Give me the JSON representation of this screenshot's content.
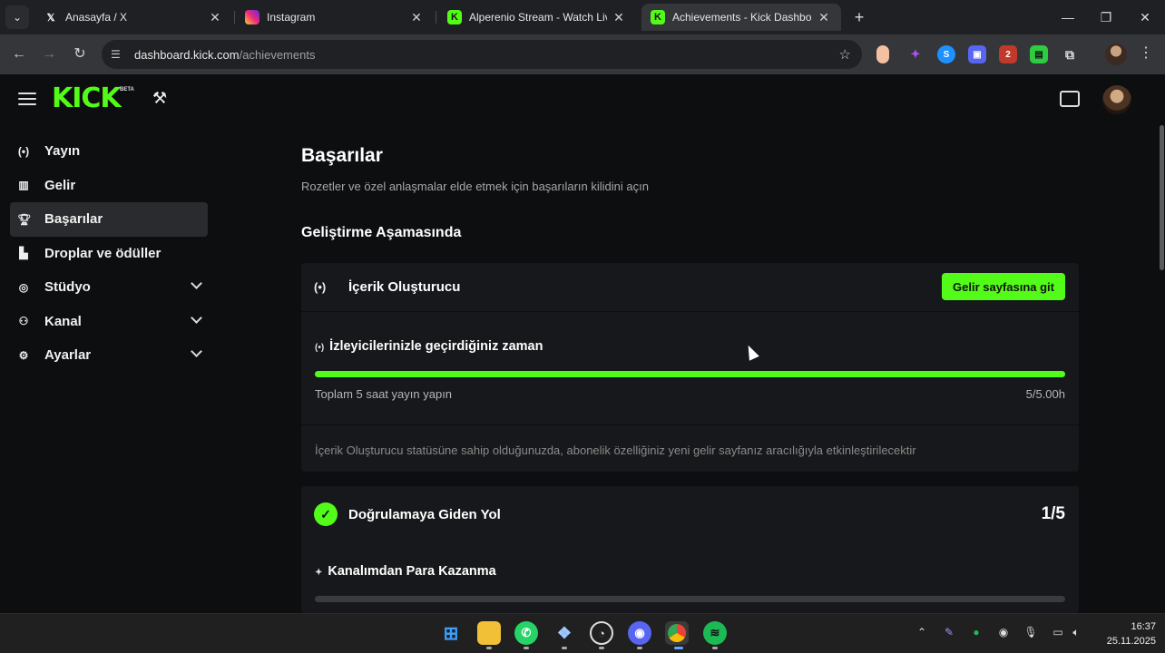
{
  "browser": {
    "tabs": [
      {
        "title": "Anasayfa / X",
        "icon": "x-logo-icon",
        "active": false
      },
      {
        "title": "Instagram",
        "icon": "instagram-icon",
        "active": false
      },
      {
        "title": "Alperenio Stream - Watch Live o",
        "icon": "kick-icon",
        "active": false
      },
      {
        "title": "Achievements - Kick Dashboard",
        "icon": "kick-icon",
        "active": true
      }
    ],
    "url_host": "dashboard.kick.com",
    "url_path": "/achievements"
  },
  "header": {
    "logo_text": "KICK",
    "beta_tag": "BETA"
  },
  "sidebar": {
    "items": [
      {
        "label": "Yayın",
        "icon": "broadcast-icon",
        "active": false,
        "expandable": false
      },
      {
        "label": "Gelir",
        "icon": "revenue-icon",
        "active": false,
        "expandable": false
      },
      {
        "label": "Başarılar",
        "icon": "trophy-icon",
        "active": true,
        "expandable": false
      },
      {
        "label": "Droplar ve ödüller",
        "icon": "gift-icon",
        "active": false,
        "expandable": false
      },
      {
        "label": "Stüdyo",
        "icon": "studio-icon",
        "active": false,
        "expandable": true
      },
      {
        "label": "Kanal",
        "icon": "channel-icon",
        "active": false,
        "expandable": true
      },
      {
        "label": "Ayarlar",
        "icon": "gear-icon",
        "active": false,
        "expandable": true
      }
    ]
  },
  "main": {
    "title": "Başarılar",
    "subtitle": "Rozetler ve özel anlaşmalar elde etmek için başarıların kilidini açın",
    "section_title": "Geliştirme Aşamasında",
    "creator_card": {
      "title": "İçerik Oluşturucu",
      "button_label": "Gelir sayfasına git",
      "progress_title": "İzleyicilerinizle geçirdiğiniz zaman",
      "progress_desc": "Toplam 5 saat yayın yapın",
      "progress_value": "5/5.00h",
      "progress_fraction": 1.0,
      "note": "İçerik Oluşturucu statüsüne sahip olduğunuzda, abonelik özelliğiniz yeni gelir sayfanız aracılığıyla etkinleştirilecektir"
    },
    "verify_card": {
      "title": "Doğrulamaya Giden Yol",
      "count": "1/5",
      "sub_title": "Kanalımdan Para Kazanma",
      "progress_fraction": 0.0
    }
  },
  "taskbar": {
    "apps": [
      "windows-start-icon",
      "file-explorer-icon",
      "whatsapp-icon",
      "app-icon",
      "obs-icon",
      "discord-icon",
      "chrome-icon",
      "spotify-icon"
    ],
    "time": "16:37",
    "date": "25.11.2025"
  },
  "colors": {
    "accent": "#53fc18",
    "background": "#0d0e10",
    "card": "#17181b"
  }
}
